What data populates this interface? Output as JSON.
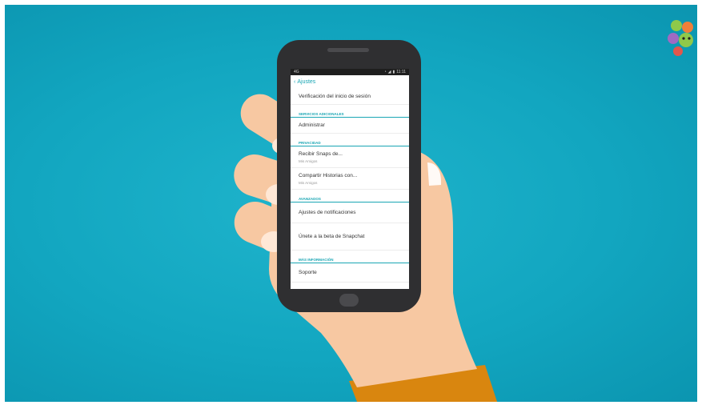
{
  "colors": {
    "background": "#12a6c0",
    "accent": "#1aa6b4",
    "phone_body": "#2f2f31",
    "skin": "#f7c8a2",
    "sleeve": "#d9860f"
  },
  "status_bar": {
    "left": "4G",
    "time": "11:11"
  },
  "header": {
    "back_icon": "chevron-left-icon",
    "title": "Ajustes"
  },
  "settings": {
    "login_verification": "Verificación del inicio de sesión",
    "section_additional": "SERVICIOS ADICIONALES",
    "manage": "Administrar",
    "section_privacy": "PRIVACIDAD",
    "receive_snaps": {
      "label": "Recibir Snaps de...",
      "value": "Mis Amigos"
    },
    "share_stories": {
      "label": "Compartir Historias con...",
      "value": "Mis Amigos"
    },
    "section_advanced": "AVANZADOS",
    "notifications": "Ajustes de notificaciones",
    "beta": "Únete a la beta de Snapchat",
    "section_more_info": "MÁS INFORMACIÓN",
    "support": "Soporte"
  }
}
